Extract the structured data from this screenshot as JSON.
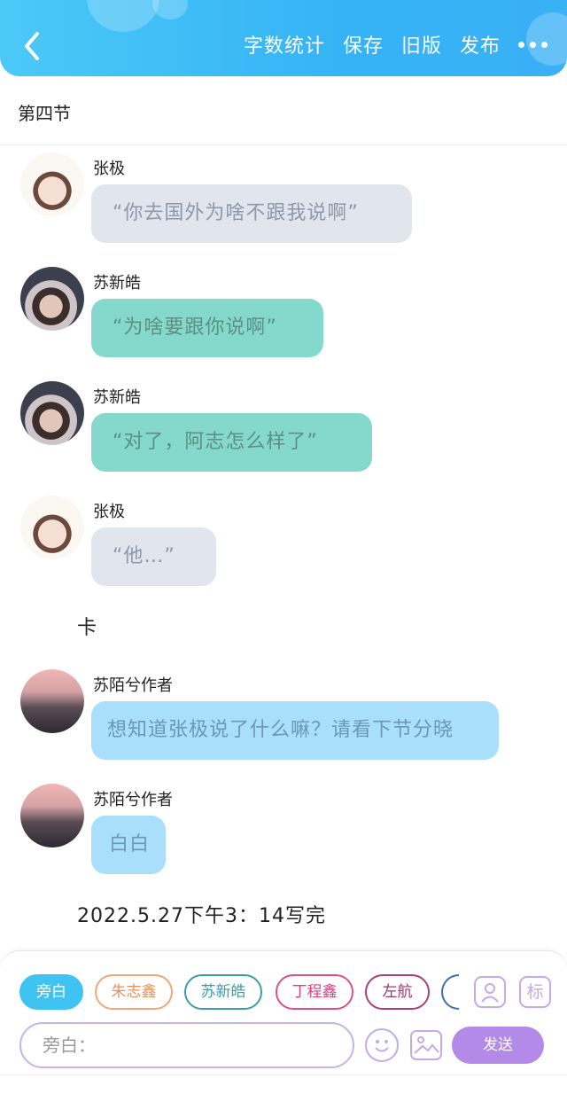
{
  "header": {
    "word_count_label": "字数统计",
    "save_label": "保存",
    "old_version_label": "旧版",
    "publish_label": "发布"
  },
  "section_title": "第四节",
  "messages": [
    {
      "speaker": "张极",
      "text": "“你去国外为啥不跟我说啊”"
    },
    {
      "speaker": "苏新皓",
      "text": "“为啥要跟你说啊”"
    },
    {
      "speaker": "苏新皓",
      "text": "“对了，阿志怎么样了”"
    },
    {
      "speaker": "张极",
      "text": "“他…”"
    }
  ],
  "narration": "卡",
  "author_messages": [
    {
      "speaker": "苏陌兮作者",
      "text": "想知道张极说了什么嘛？请看下节分晓"
    },
    {
      "speaker": "苏陌兮作者",
      "text": "白白"
    }
  ],
  "timestamp": "2022.5.27下午3：14写完",
  "composer": {
    "chips": [
      "旁白",
      "朱志鑫",
      "苏新皓",
      "丁程鑫",
      "左航"
    ],
    "input_placeholder": "旁白：",
    "tag_icon_label": "标",
    "send_label": "发送"
  },
  "colors": {
    "header_gradient_start": "#4cc9f6",
    "header_gradient_end": "#3ab0f5",
    "bubble_gray": "#e1e6ee",
    "bubble_teal": "#85d9cc",
    "bubble_blue": "#aadffb",
    "send_button": "#b38ae8"
  }
}
